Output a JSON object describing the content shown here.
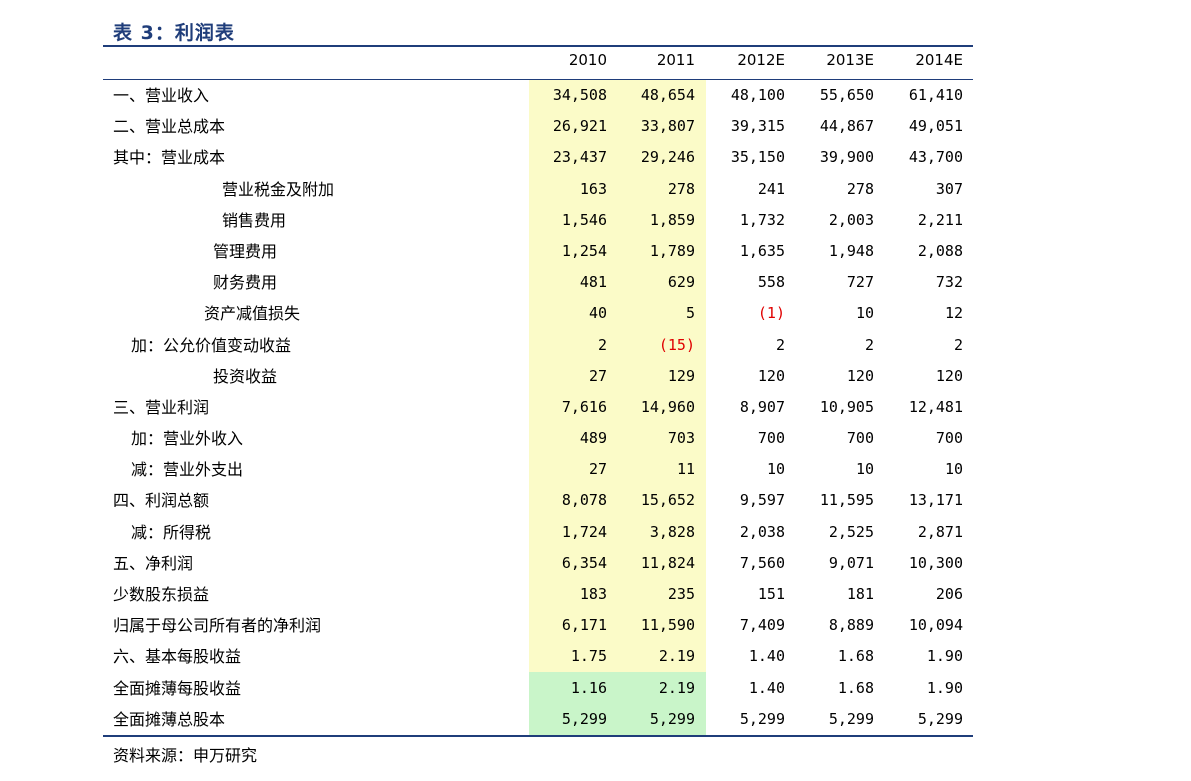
{
  "title": "表 3：利润表",
  "headers": [
    "2010",
    "2011",
    "2012E",
    "2013E",
    "2014E"
  ],
  "source": "资料来源：申万研究",
  "highlight_colors": {
    "yellow": "#fbfbc8",
    "green": "#c9f5c9",
    "rule": "#1f3d7a",
    "negative": "#e00000"
  },
  "rows": [
    {
      "label": "一、营业收入",
      "indent": 0,
      "values": [
        "34,508",
        "48,654",
        "48,100",
        "55,650",
        "61,410"
      ]
    },
    {
      "label": "二、营业总成本",
      "indent": 0,
      "values": [
        "26,921",
        "33,807",
        "39,315",
        "44,867",
        "49,051"
      ]
    },
    {
      "label": "其中：营业成本",
      "indent": 0,
      "values": [
        "23,437",
        "29,246",
        "35,150",
        "39,900",
        "43,700"
      ]
    },
    {
      "label": "营业税金及附加",
      "indent": 3,
      "values": [
        "163",
        "278",
        "241",
        "278",
        "307"
      ]
    },
    {
      "label": "销售费用",
      "indent": 3,
      "values": [
        "1,546",
        "1,859",
        "1,732",
        "2,003",
        "2,211"
      ]
    },
    {
      "label": "管理费用",
      "indent": 2,
      "values": [
        "1,254",
        "1,789",
        "1,635",
        "1,948",
        "2,088"
      ]
    },
    {
      "label": "财务费用",
      "indent": 2,
      "values": [
        "481",
        "629",
        "558",
        "727",
        "732"
      ]
    },
    {
      "label": "资产减值损失",
      "indent": 1,
      "values": [
        "40",
        "5",
        "(1)",
        "10",
        "12"
      ]
    },
    {
      "label": "加：公允价值变动收益",
      "indent": 4,
      "values": [
        "2",
        "(15)",
        "2",
        "2",
        "2"
      ]
    },
    {
      "label": "投资收益",
      "indent": 2,
      "values": [
        "27",
        "129",
        "120",
        "120",
        "120"
      ]
    },
    {
      "label": "三、营业利润",
      "indent": 0,
      "values": [
        "7,616",
        "14,960",
        "8,907",
        "10,905",
        "12,481"
      ]
    },
    {
      "label": "加：营业外收入",
      "indent": 4,
      "values": [
        "489",
        "703",
        "700",
        "700",
        "700"
      ]
    },
    {
      "label": "减：营业外支出",
      "indent": 4,
      "values": [
        "27",
        "11",
        "10",
        "10",
        "10"
      ]
    },
    {
      "label": "四、利润总额",
      "indent": 0,
      "values": [
        "8,078",
        "15,652",
        "9,597",
        "11,595",
        "13,171"
      ]
    },
    {
      "label": "减：所得税",
      "indent": 4,
      "values": [
        "1,724",
        "3,828",
        "2,038",
        "2,525",
        "2,871"
      ]
    },
    {
      "label": "五、净利润",
      "indent": 0,
      "values": [
        "6,354",
        "11,824",
        "7,560",
        "9,071",
        "10,300"
      ]
    },
    {
      "label": "少数股东损益",
      "indent": 0,
      "values": [
        "183",
        "235",
        "151",
        "181",
        "206"
      ]
    },
    {
      "label": "归属于母公司所有者的净利润",
      "indent": 0,
      "values": [
        "6,171",
        "11,590",
        "7,409",
        "8,889",
        "10,094"
      ]
    },
    {
      "label": "六、基本每股收益",
      "indent": 0,
      "values": [
        "1.75",
        "2.19",
        "1.40",
        "1.68",
        "1.90"
      ]
    },
    {
      "label": "全面摊薄每股收益",
      "indent": 0,
      "values": [
        "1.16",
        "2.19",
        "1.40",
        "1.68",
        "1.90"
      ]
    },
    {
      "label": "全面摊薄总股本",
      "indent": 0,
      "values": [
        "5,299",
        "5,299",
        "5,299",
        "5,299",
        "5,299"
      ]
    }
  ]
}
